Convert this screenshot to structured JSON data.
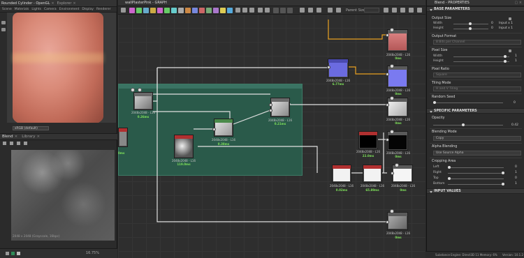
{
  "viewport3d": {
    "tab_title": "Rounded Cylinder - OpenGL",
    "tab_explorer": "Explorer",
    "menu": [
      "Scene",
      "Materials",
      "Lights",
      "Camera",
      "Environment",
      "Display",
      "Renderer"
    ],
    "color_space": "sRGB (default)"
  },
  "view2d": {
    "tab_blend": "Blend",
    "tab_library": "Library",
    "texture_info": "2048 x 2048 (Grayscale, 16bpc)",
    "zoom": "16.75%"
  },
  "graph": {
    "title": "wallPlasterPink - GRAPH",
    "parent_size_label": "Parent Size:",
    "nodes": [
      {
        "id": "n_out1",
        "res": "2048x2048 - L16",
        "time": "0ms"
      },
      {
        "id": "n_out2",
        "res": "2048x2048 - L16",
        "time": "0ms"
      },
      {
        "id": "n_normal",
        "res": "2048x2048 - L16",
        "time": "6.77ms"
      },
      {
        "id": "n_out3",
        "res": "2048x2048 - L16",
        "time": "0ms"
      },
      {
        "id": "n_blend",
        "res": "2048x2048 - L16",
        "time": "0.21ms"
      },
      {
        "id": "n_left",
        "res": "2048x2048 - L16",
        "time": "0.26ms"
      },
      {
        "id": "n_green",
        "res": "2048x2048 - L16",
        "time": "0.38ms"
      },
      {
        "id": "n_noise",
        "res": "2048x2048 - L16",
        "time": "119.0ms"
      },
      {
        "id": "n_black",
        "res": "2048x2048 - L16",
        "time": "22.0ms"
      },
      {
        "id": "n_out4",
        "res": "2048x2048 - L16",
        "time": "0ms"
      },
      {
        "id": "n_red1",
        "res": "2048x2048 - L16",
        "time": "0.02ms"
      },
      {
        "id": "n_red2",
        "res": "2048x2048 - L16",
        "time": "65.89ms"
      },
      {
        "id": "n_out5",
        "res": "2048x2048 - L16",
        "time": "0ms"
      },
      {
        "id": "n_out6",
        "res": "2048x2048 - L16",
        "time": "0ms"
      },
      {
        "id": "n_clip",
        "time": "0ms"
      }
    ]
  },
  "props": {
    "title": "Blend - PROPERTIES",
    "base_section": "BASE PARAMETERS",
    "output_size": "Output Size",
    "width": "Width",
    "height": "Height",
    "output_size_w": "0",
    "output_size_h": "0",
    "output_size_w_unit": "Input x 1",
    "output_size_h_unit": "Input x 1",
    "output_format": "Output Format",
    "output_format_val": "8 Bits per Channel",
    "pixel_size": "Pixel Size",
    "pixel_w": "1",
    "pixel_h": "1",
    "pixel_ratio": "Pixel Ratio",
    "pixel_ratio_val": "Square",
    "tiling_mode": "Tiling Mode",
    "tiling_val": "H and V Tiling",
    "random_seed": "Random Seed",
    "random_seed_val": "0",
    "specific_section": "SPECIFIC PARAMETERS",
    "opacity": "Opacity",
    "opacity_val": "0.42",
    "blending_mode": "Blending Mode",
    "blending_val": "Copy",
    "alpha_blending": "Alpha Blending",
    "alpha_val": "Use Source Alpha",
    "cropping": "Cropping Area",
    "crop_left": "Left",
    "crop_right": "Right",
    "crop_top": "Top",
    "crop_bottom": "Bottom",
    "crop_left_val": "0",
    "crop_right_val": "1",
    "crop_top_val": "0",
    "crop_bottom_val": "1",
    "input_values": "INPUT VALUES"
  },
  "status": {
    "engine": "Substance Engine: Direct3D 11  Memory: 6%",
    "version": "Version: 10.1.2"
  },
  "colors": {
    "frame": "#2a5a4a",
    "normal_node": "#6b6be0",
    "wire_orange": "#e8a020",
    "wire_white": "#e0e0e0",
    "time_green": "#7ee05a"
  }
}
